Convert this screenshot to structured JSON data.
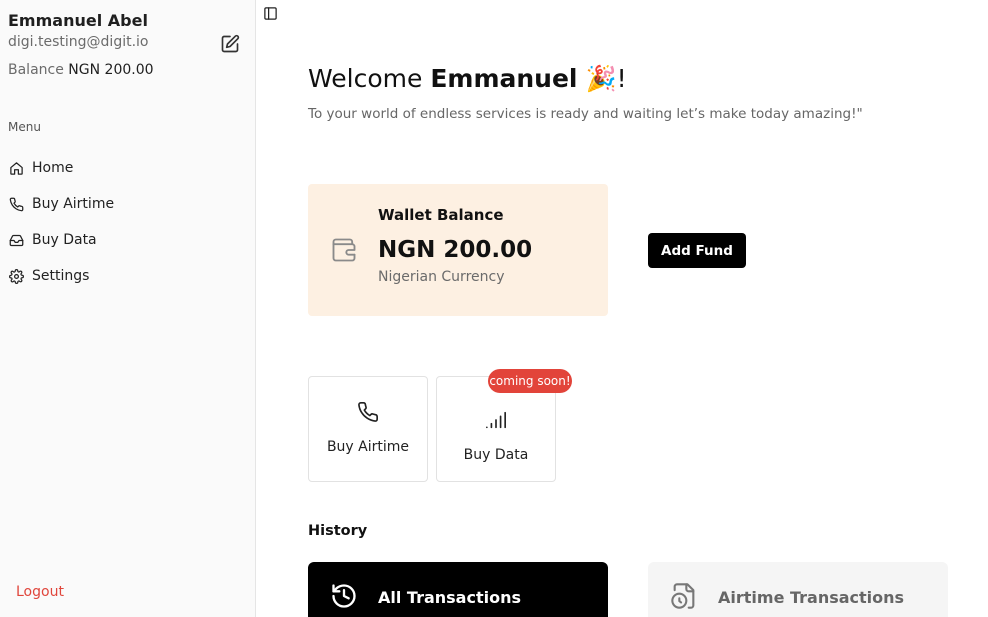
{
  "user": {
    "name": "Emmanuel Abel",
    "email": "digi.testing@digit.io",
    "balance_label": "Balance",
    "balance_value": "NGN 200.00"
  },
  "sidebar": {
    "menu_heading": "Menu",
    "items": [
      {
        "label": "Home",
        "icon": "home-icon"
      },
      {
        "label": "Buy Airtime",
        "icon": "phone-icon"
      },
      {
        "label": "Buy Data",
        "icon": "inbox-icon"
      },
      {
        "label": "Settings",
        "icon": "gear-icon"
      }
    ],
    "logout_label": "Logout"
  },
  "main": {
    "welcome_prefix": "Welcome",
    "welcome_name": "Emmanuel",
    "welcome_emoji": "🎉",
    "welcome_suffix": "!",
    "subtitle": "To your world of endless services is ready and waiting let’s make today amazing!\""
  },
  "wallet": {
    "title": "Wallet Balance",
    "amount": "NGN 200.00",
    "currency": "Nigerian Currency",
    "add_fund_label": "Add Fund"
  },
  "services": [
    {
      "label": "Buy Airtime",
      "icon": "phone-icon"
    },
    {
      "label": "Buy Data",
      "icon": "signal-icon",
      "badge": "coming soon!"
    }
  ],
  "history": {
    "heading": "History",
    "tabs": [
      {
        "label": "All Transactions",
        "icon": "history-icon",
        "active": true
      },
      {
        "label": "Airtime Transactions",
        "icon": "file-clock-icon",
        "active": false
      }
    ]
  },
  "colors": {
    "accent": "#000000",
    "wallet_bg": "#fdf0e2",
    "badge": "#e2443a",
    "logout": "#e0463c"
  }
}
